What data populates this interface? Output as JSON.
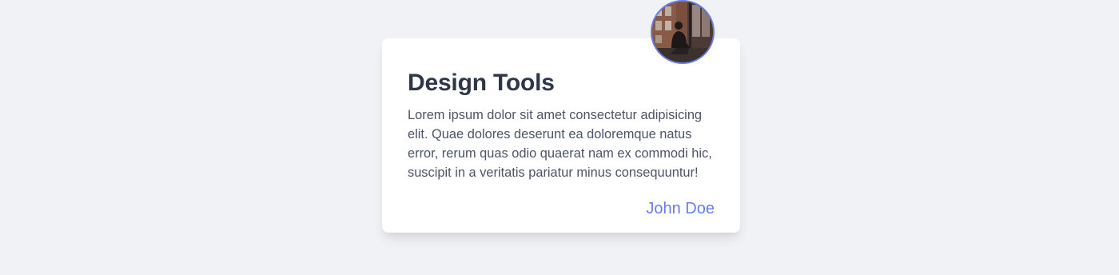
{
  "card": {
    "title": "Design Tools",
    "body": "Lorem ipsum dolor sit amet consectetur adipisicing elit. Quae dolores deserunt ea doloremque natus error, rerum quas odio quaerat nam ex commodi hic, suscipit in a veritatis pariatur minus consequuntur!",
    "author": "John Doe"
  },
  "colors": {
    "background": "#f0f2f5",
    "card": "#ffffff",
    "title": "#2d3748",
    "body": "#4a5568",
    "accent": "#667eea"
  }
}
